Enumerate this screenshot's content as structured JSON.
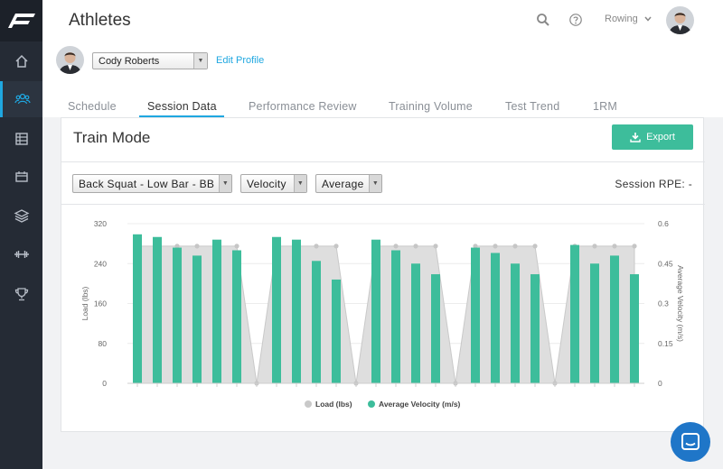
{
  "sidebar": {
    "logo": "brand-logo",
    "items": [
      {
        "icon": "home-icon"
      },
      {
        "icon": "athletes-icon",
        "active": true
      },
      {
        "icon": "table-icon"
      },
      {
        "icon": "calendar-icon"
      },
      {
        "icon": "layers-icon"
      },
      {
        "icon": "dumbbell-icon"
      },
      {
        "icon": "trophy-icon"
      }
    ]
  },
  "header": {
    "title": "Athletes",
    "sport": "Rowing"
  },
  "athlete": {
    "name": "Cody Roberts",
    "edit_label": "Edit Profile"
  },
  "tabs": [
    {
      "label": "Schedule"
    },
    {
      "label": "Session Data",
      "active": true
    },
    {
      "label": "Performance Review"
    },
    {
      "label": "Training Volume"
    },
    {
      "label": "Test Trend"
    },
    {
      "label": "1RM"
    }
  ],
  "card": {
    "title": "Train Mode",
    "export_label": "Export",
    "filters": {
      "exercise": "Back Squat - Low Bar - BB",
      "metric": "Velocity",
      "aggregate": "Average"
    },
    "rpe_label": "Session RPE: -"
  },
  "colors": {
    "accent": "#1fa7e0",
    "velocity": "#3dbd9b",
    "load": "#d3d3d3",
    "sidebar": "#252b35"
  },
  "chart_data": {
    "type": "bar",
    "ylabel": "Load (lbs)",
    "y2label": "Average Velocity (m/s)",
    "ylim": [
      0,
      320
    ],
    "y2lim": [
      0,
      0.6
    ],
    "yticks": [
      "0",
      "80",
      "160",
      "240",
      "320"
    ],
    "y2ticks": [
      "0",
      "0.15",
      "0.3",
      "0.45",
      "0.6"
    ],
    "grid": true,
    "legend": "bottom",
    "series": [
      {
        "name": "Load (lbs)",
        "type": "area",
        "values": [
          275,
          275,
          275,
          275,
          275,
          275,
          0,
          275,
          275,
          275,
          275,
          0,
          275,
          275,
          275,
          275,
          0,
          275,
          275,
          275,
          275,
          0,
          275,
          275,
          275,
          275
        ]
      },
      {
        "name": "Average Velocity (m/s)",
        "type": "bar",
        "values": [
          0.56,
          0.55,
          0.51,
          0.48,
          0.54,
          0.5,
          null,
          0.55,
          0.54,
          0.46,
          0.39,
          null,
          0.54,
          0.5,
          0.45,
          0.41,
          null,
          0.51,
          0.49,
          0.45,
          0.41,
          null,
          0.52,
          0.45,
          0.48,
          0.41
        ]
      }
    ]
  }
}
